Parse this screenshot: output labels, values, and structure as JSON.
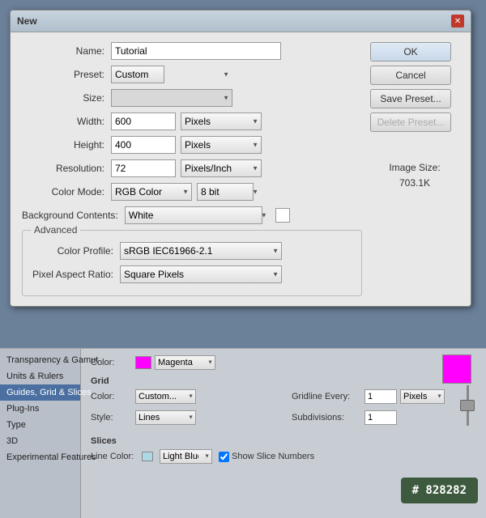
{
  "dialog": {
    "title": "New",
    "close_label": "✕",
    "fields": {
      "name_label": "Name:",
      "name_value": "Tutorial",
      "preset_label": "Preset:",
      "preset_value": "Custom",
      "size_label": "Size:",
      "width_label": "Width:",
      "width_value": "600",
      "height_label": "Height:",
      "height_value": "400",
      "resolution_label": "Resolution:",
      "resolution_value": "72",
      "color_mode_label": "Color Mode:",
      "color_mode_value": "RGB Color",
      "bit_depth_value": "8 bit",
      "bg_contents_label": "Background Contents:",
      "bg_contents_value": "White",
      "advanced_label": "Advanced",
      "color_profile_label": "Color Profile:",
      "color_profile_value": "sRGB IEC61966-2.1",
      "pixel_aspect_label": "Pixel Aspect Ratio:",
      "pixel_aspect_value": "Square Pixels"
    },
    "units": {
      "pixels": "Pixels",
      "pixels_inch": "Pixels/Inch"
    },
    "buttons": {
      "ok": "OK",
      "cancel": "Cancel",
      "save_preset": "Save Preset...",
      "delete_preset": "Delete Preset..."
    },
    "image_size_label": "Image Size:",
    "image_size_value": "703.1K"
  },
  "bottom": {
    "sidebar": {
      "items": [
        {
          "label": "Transparency & Gamut"
        },
        {
          "label": "Units & Rulers"
        },
        {
          "label": "Guides, Grid & Slices",
          "active": true
        },
        {
          "label": "Plug-Ins"
        },
        {
          "label": "Type"
        },
        {
          "label": "3D"
        },
        {
          "label": "Experimental Features"
        }
      ]
    },
    "color_label": "Color:",
    "color_value": "Magenta",
    "grid": {
      "title": "Grid",
      "color_label": "Color:",
      "color_value": "Custom...",
      "style_label": "Style:",
      "style_value": "Lines",
      "gridline_label": "Gridline Every:",
      "gridline_value": "1",
      "gridline_unit": "Pixels",
      "subdivisions_label": "Subdivisions:",
      "subdivisions_value": "1"
    },
    "slices": {
      "title": "Slices",
      "line_color_label": "Line Color:",
      "line_color_value": "Light Blue",
      "show_numbers_label": "Show Slice Numbers",
      "show_numbers_checked": true
    },
    "tooltip": "# 828282"
  }
}
